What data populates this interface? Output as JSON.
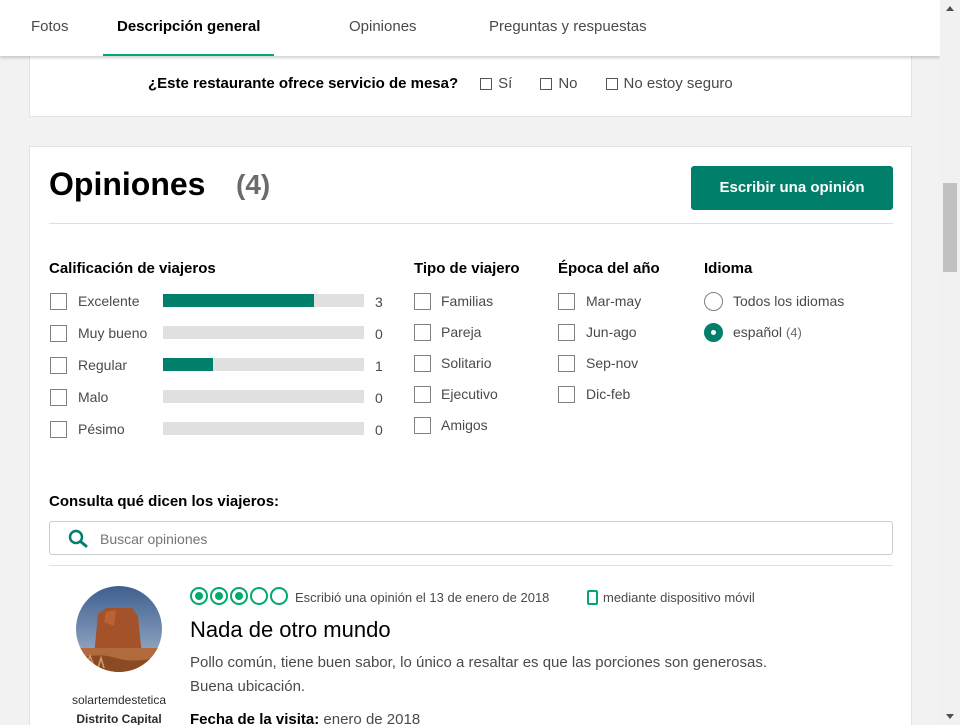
{
  "tabs": [
    {
      "label": "Fotos"
    },
    {
      "label": "Descripción general"
    },
    {
      "label": "Opiniones"
    },
    {
      "label": "Preguntas y respuestas"
    }
  ],
  "service_question": {
    "text": "¿Este restaurante ofrece servicio de mesa?",
    "options": [
      "Sí",
      "No",
      "No estoy seguro"
    ]
  },
  "reviews": {
    "title": "Opiniones",
    "count": "(4)",
    "write_button": "Escribir una opinión",
    "rating_header": "Calificación de viajeros",
    "ratings": [
      {
        "label": "Excelente",
        "count": "3",
        "fraction": 0.75
      },
      {
        "label": "Muy bueno",
        "count": "0",
        "fraction": 0
      },
      {
        "label": "Regular",
        "count": "1",
        "fraction": 0.25
      },
      {
        "label": "Malo",
        "count": "0",
        "fraction": 0
      },
      {
        "label": "Pésimo",
        "count": "0",
        "fraction": 0
      }
    ],
    "traveler_header": "Tipo de viajero",
    "traveler_types": [
      "Familias",
      "Pareja",
      "Solitario",
      "Ejecutivo",
      "Amigos"
    ],
    "season_header": "Época del año",
    "seasons": [
      "Mar-may",
      "Jun-ago",
      "Sep-nov",
      "Dic-feb"
    ],
    "language_header": "Idioma",
    "languages": [
      {
        "label": "Todos los idiomas",
        "sub": "",
        "selected": false
      },
      {
        "label": "español",
        "sub": "(4)",
        "selected": true
      }
    ],
    "search_label": "Consulta qué dicen los viajeros:",
    "search_placeholder": "Buscar opiniones"
  },
  "review_item": {
    "username": "solartemdestetica",
    "location": "Distrito Capital",
    "rating_bubbles": 3,
    "meta": "Escribió una opinión el 13 de enero de 2018",
    "mobile_text": "mediante dispositivo móvil",
    "title": "Nada de otro mundo",
    "body": "Pollo común, tiene buen sabor, lo único a resaltar es que las porciones son generosas. Buena ubicación.",
    "visit_label": "Fecha de la visita:",
    "visit_value": "enero de 2018"
  },
  "colors": {
    "accent": "#00806a",
    "bubble": "#00aa6c"
  },
  "icons": [
    "search-icon",
    "mobile-icon",
    "scroll-up-icon",
    "scroll-down-icon"
  ]
}
